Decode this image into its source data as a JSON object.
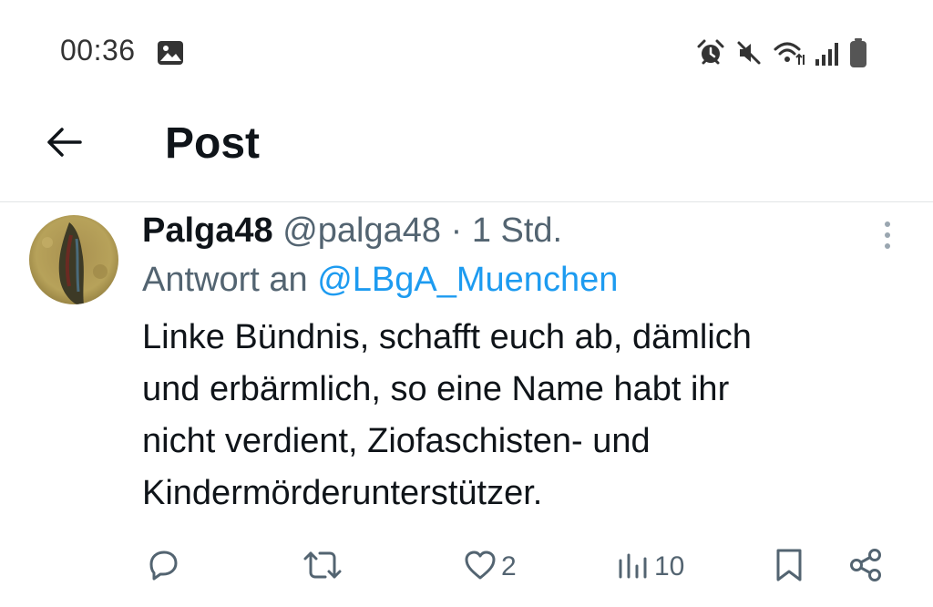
{
  "status_bar": {
    "time": "00:36",
    "left_icons": [
      "image-icon"
    ],
    "right_icons": [
      "alarm-icon",
      "muted-icon",
      "wifi-icon",
      "signal-icon",
      "battery-icon"
    ]
  },
  "header": {
    "title": "Post",
    "back_icon": "arrow-left-icon"
  },
  "post": {
    "author_name": "Palga48",
    "author_handle": "@palga48",
    "separator": "·",
    "time": "1 Std.",
    "reply_prefix": "Antwort an",
    "reply_mention": "@LBgA_Muenchen",
    "body": "Linke Bündnis, schafft euch ab, dämlich\nund erbärmlich, so eine Name habt ihr\nnicht verdient, Ziofaschisten- und\nKindermörderunterstützer.",
    "more_icon": "more-vertical-icon"
  },
  "actions": {
    "reply": {
      "icon": "reply-icon",
      "count": ""
    },
    "repost": {
      "icon": "repost-icon",
      "count": ""
    },
    "like": {
      "icon": "heart-icon",
      "count": "2"
    },
    "views": {
      "icon": "views-icon",
      "count": "10"
    },
    "bookmark": {
      "icon": "bookmark-icon"
    },
    "share": {
      "icon": "share-icon"
    }
  },
  "colors": {
    "text": "#0f1419",
    "secondary": "#536471",
    "link": "#1d9bf0",
    "divider": "#e1e4e6"
  }
}
